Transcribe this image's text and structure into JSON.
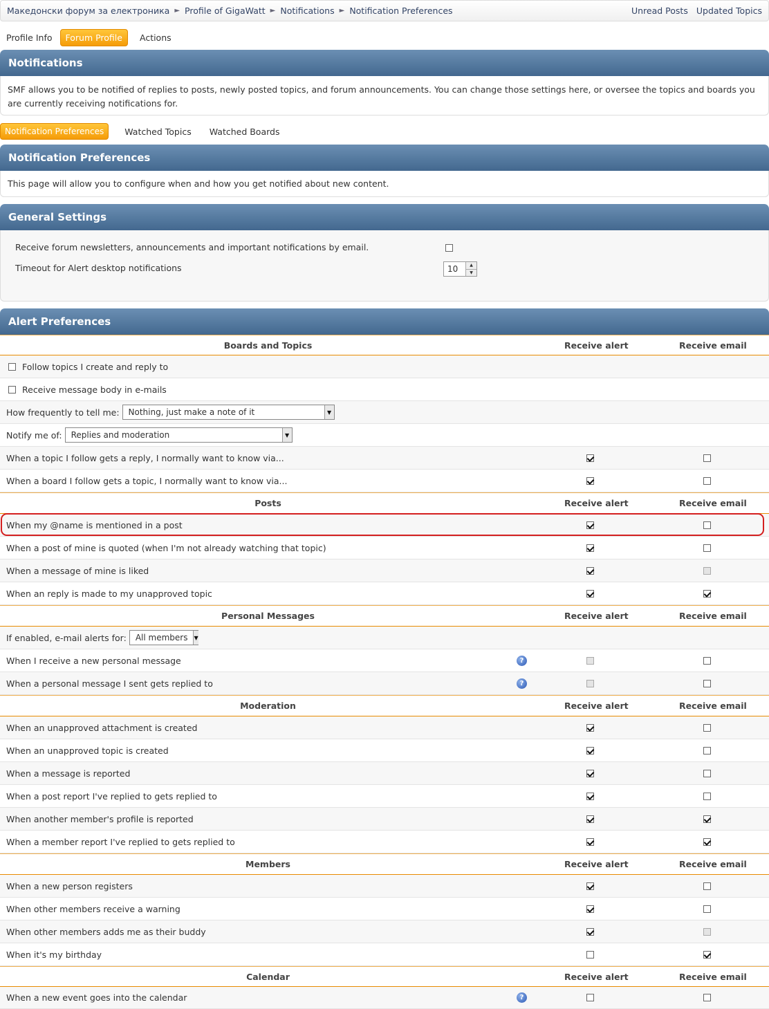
{
  "breadcrumb": {
    "items": [
      "Македонски форум за електроника",
      "Profile of GigaWatt",
      "Notifications",
      "Notification Preferences"
    ],
    "separator": "►"
  },
  "quick_links": [
    "Unread Posts",
    "Updated Topics"
  ],
  "profile_tabs": [
    "Profile Info",
    "Forum Profile",
    "Actions"
  ],
  "notifications": {
    "title": "Notifications",
    "description": "SMF allows you to be notified of replies to posts, newly posted topics, and forum announcements. You can change those settings here, or oversee the topics and boards you are currently receiving notifications for."
  },
  "notification_tabs": [
    "Notification Preferences",
    "Watched Topics",
    "Watched Boards"
  ],
  "preferences": {
    "title": "Notification Preferences",
    "description": "This page will allow you to configure when and how you get notified about new content."
  },
  "general": {
    "title": "General Settings",
    "newsletter_label": "Receive forum newsletters, announcements and important notifications by email.",
    "newsletter_checked": false,
    "timeout_label": "Timeout for Alert desktop notifications",
    "timeout_value": "10"
  },
  "alerts": {
    "title": "Alert Preferences",
    "col_alert": "Receive alert",
    "col_email": "Receive email",
    "boards": {
      "heading": "Boards and Topics",
      "follow_label": "Follow topics I create and reply to",
      "body_label": "Receive message body in e-mails",
      "frequency_label": "How frequently to tell me:",
      "frequency_value": "Nothing, just make a note of it",
      "notify_label": "Notify me of:",
      "notify_value": "Replies and moderation",
      "topic_reply": "When a topic I follow gets a reply, I normally want to know via...",
      "board_topic": "When a board I follow gets a topic, I normally want to know via..."
    },
    "posts": {
      "heading": "Posts",
      "mention": "When my @name is mentioned in a post",
      "quoted": "When a post of mine is quoted (when I'm not already watching that topic)",
      "liked": "When a message of mine is liked",
      "unapproved_reply": "When an reply is made to my unapproved topic"
    },
    "pm": {
      "heading": "Personal Messages",
      "email_alerts_label": "If enabled, e-mail alerts for:",
      "email_alerts_value": "All members",
      "new_pm": "When I receive a new personal message",
      "pm_replied": "When a personal message I sent gets replied to"
    },
    "moderation": {
      "heading": "Moderation",
      "attachment": "When an unapproved attachment is created",
      "topic": "When an unapproved topic is created",
      "reported": "When a message is reported",
      "report_reply": "When a post report I've replied to gets replied to",
      "profile_reported": "When another member's profile is reported",
      "member_report_reply": "When a member report I've replied to gets replied to"
    },
    "members": {
      "heading": "Members",
      "registers": "When a new person registers",
      "warning": "When other members receive a warning",
      "buddy": "When other members adds me as their buddy",
      "birthday": "When it's my birthday"
    },
    "calendar": {
      "heading": "Calendar",
      "event": "When a new event goes into the calendar"
    },
    "help_icon_glyph": "?"
  }
}
